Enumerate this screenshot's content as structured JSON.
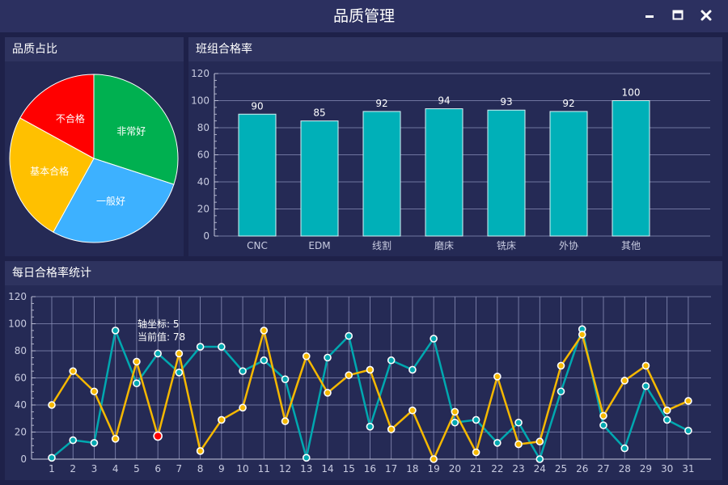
{
  "window": {
    "title": "品质管理",
    "controls": {
      "minimize": "minimize-icon",
      "maximize": "maximize-icon",
      "close": "close-icon"
    }
  },
  "panels": {
    "pie": {
      "title": "品质占比"
    },
    "bar": {
      "title": "班组合格率"
    },
    "line": {
      "title": "每日合格率统计"
    }
  },
  "tooltip": {
    "axis_label": "轴坐标: 5",
    "value_label": "当前值: 78"
  },
  "chart_data": [
    {
      "type": "pie",
      "slices": [
        {
          "label": "非常好",
          "value": 30,
          "color": "#00b050"
        },
        {
          "label": "一般好",
          "value": 28,
          "color": "#3db1ff"
        },
        {
          "label": "基本合格",
          "value": 25,
          "color": "#ffc000"
        },
        {
          "label": "不合格",
          "value": 17,
          "color": "#ff0000"
        }
      ]
    },
    {
      "type": "bar",
      "categories": [
        "CNC",
        "EDM",
        "线割",
        "磨床",
        "铣床",
        "外协",
        "其他"
      ],
      "values": [
        90,
        85,
        92,
        94,
        93,
        92,
        100
      ],
      "ylim": [
        0,
        120
      ],
      "yticks": [
        0,
        20,
        40,
        60,
        80,
        100,
        120
      ],
      "bar_color": "#00b0b8"
    },
    {
      "type": "line",
      "x": [
        1,
        2,
        3,
        4,
        5,
        6,
        7,
        8,
        9,
        10,
        11,
        12,
        13,
        14,
        15,
        16,
        17,
        18,
        19,
        20,
        21,
        22,
        23,
        24,
        25,
        26,
        27,
        28,
        29,
        30,
        31
      ],
      "ylim": [
        0,
        120
      ],
      "yticks": [
        0,
        20,
        40,
        60,
        80,
        100,
        120
      ],
      "grid": true,
      "series": [
        {
          "color": "#00a8b0",
          "values": [
            1,
            14,
            12,
            95,
            56,
            78,
            64,
            83,
            83,
            65,
            73,
            59,
            1,
            75,
            91,
            24,
            73,
            66,
            89,
            27,
            29,
            12,
            27,
            0,
            50,
            96,
            25,
            8,
            54,
            29,
            21
          ]
        },
        {
          "color": "#f5b800",
          "values": [
            40,
            65,
            50,
            15,
            72,
            17,
            78,
            6,
            29,
            38,
            95,
            28,
            76,
            49,
            62,
            66,
            22,
            36,
            0,
            35,
            5,
            61,
            11,
            13,
            69,
            92,
            32,
            58,
            69,
            36,
            43
          ]
        }
      ],
      "highlight": {
        "x": 6,
        "series": 1,
        "color": "#ff0000"
      }
    }
  ]
}
